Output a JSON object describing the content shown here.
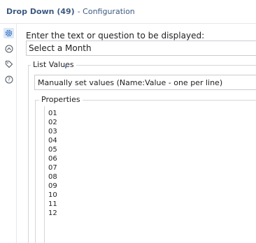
{
  "window": {
    "title": "Drop Down (49)",
    "subtitle": "- Configuration"
  },
  "rail": {
    "icons": [
      "gear-icon",
      "arrow-circle-icon",
      "tag-icon",
      "help-icon"
    ],
    "active_color": "#2f6fc2"
  },
  "prompt": {
    "label": "Enter the text or question to be displayed:",
    "value": "Select a Month"
  },
  "list_values": {
    "group_title": "List Values",
    "mode_selected": "Manually set values (Name:Value - one per line)"
  },
  "properties": {
    "group_title": "Properties",
    "lines": [
      "01",
      "02",
      "03",
      "04",
      "05",
      "06",
      "07",
      "08",
      "09",
      "10",
      "11",
      "12"
    ]
  }
}
